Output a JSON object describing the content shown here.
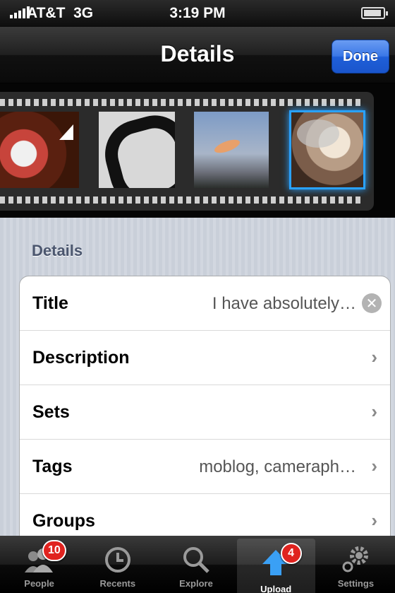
{
  "status_bar": {
    "carrier": "AT&T",
    "network": "3G",
    "time": "3:19 PM"
  },
  "nav": {
    "title": "Details",
    "done_label": "Done"
  },
  "filmstrip": {
    "photo_count": 4,
    "selected_index": 3
  },
  "section": {
    "header": "Details"
  },
  "fields": [
    {
      "label": "Title",
      "value": "I have absolutely…"
    },
    {
      "label": "Description",
      "value": ""
    },
    {
      "label": "Sets",
      "value": ""
    },
    {
      "label": "Tags",
      "value": "moblog, cameraph…"
    },
    {
      "label": "Groups",
      "value": ""
    }
  ],
  "tabs": [
    {
      "label": "People",
      "badge": "10",
      "icon": "people-icon"
    },
    {
      "label": "Recents",
      "icon": "clock-icon"
    },
    {
      "label": "Explore",
      "icon": "magnifier-icon"
    },
    {
      "label": "Upload",
      "badge": "4",
      "icon": "upload-arrow-icon",
      "active": true
    },
    {
      "label": "Settings",
      "icon": "gear-icon"
    }
  ],
  "colors": {
    "accent": "#2a7ae2",
    "badge": "#e0231f",
    "selection_glow": "#2aa2ff"
  }
}
